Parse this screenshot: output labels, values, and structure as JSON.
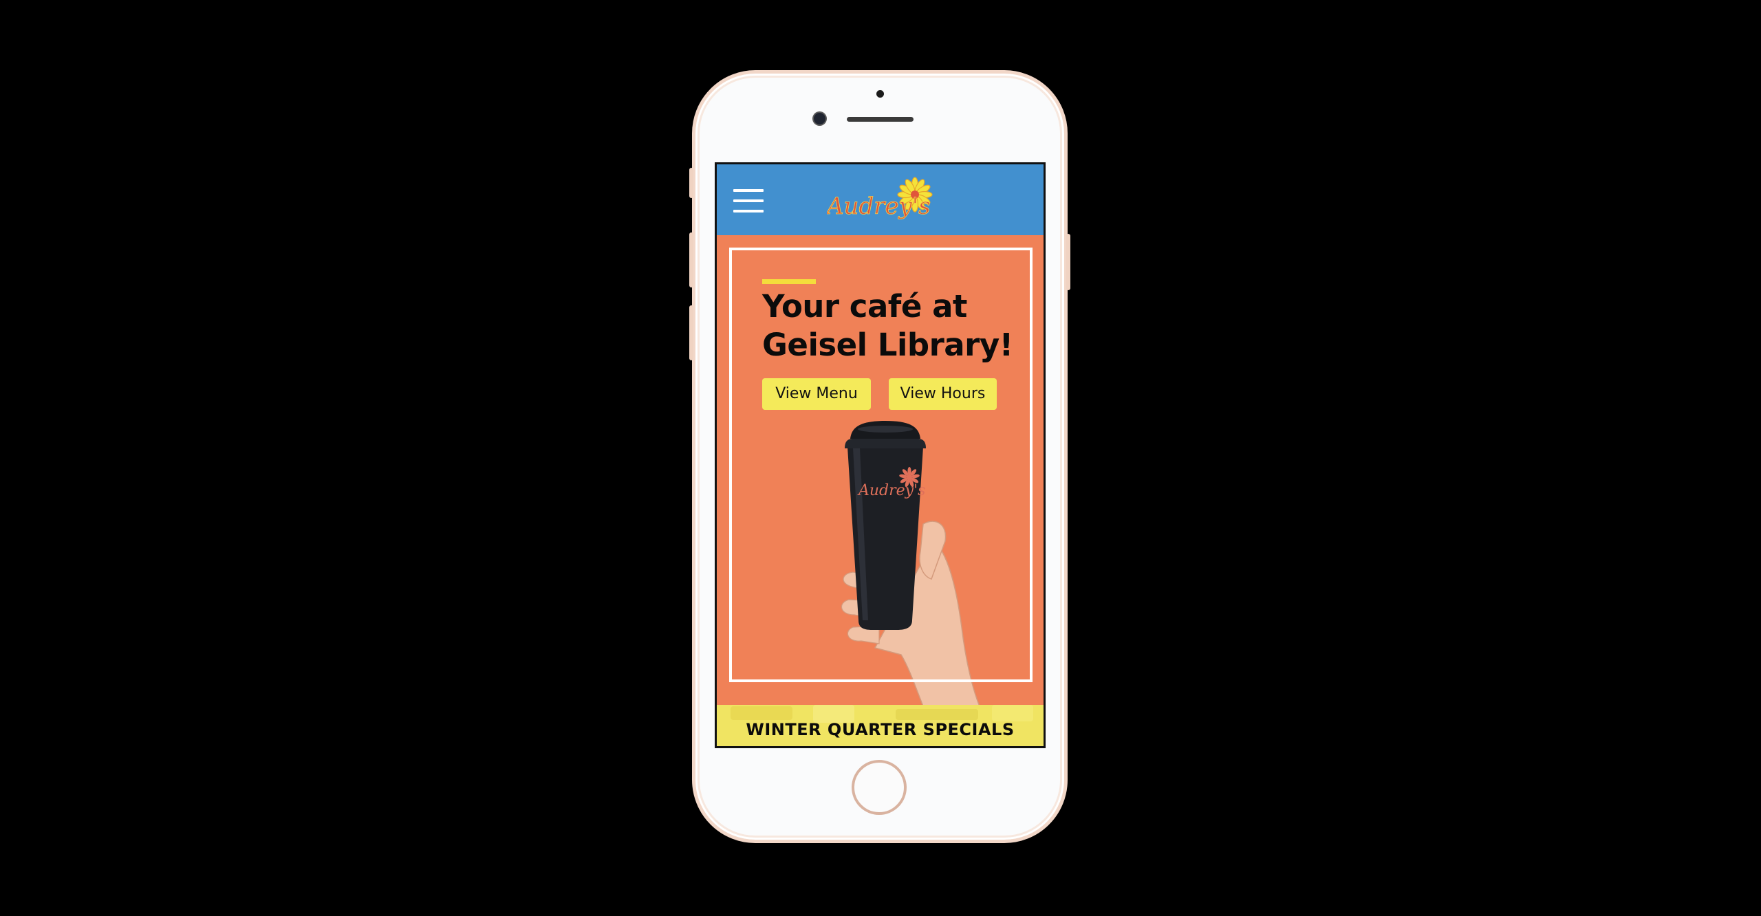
{
  "brand": {
    "logo_text": "Audrey's",
    "colors": {
      "nav": "#4290cf",
      "hero": "#f08157",
      "accent": "#f4dd3c",
      "button": "#f4ea5a",
      "logo_text": "#e0553b"
    }
  },
  "nav": {
    "menu_icon": "hamburger-icon"
  },
  "hero": {
    "headline_line1": "Your café at",
    "headline_line2": "Geisel Library!",
    "buttons": {
      "menu": "View Menu",
      "hours": "View Hours"
    },
    "image": "hand-holding-branded-cup"
  },
  "specials": {
    "title": "WINTER QUARTER SPECIALS"
  }
}
